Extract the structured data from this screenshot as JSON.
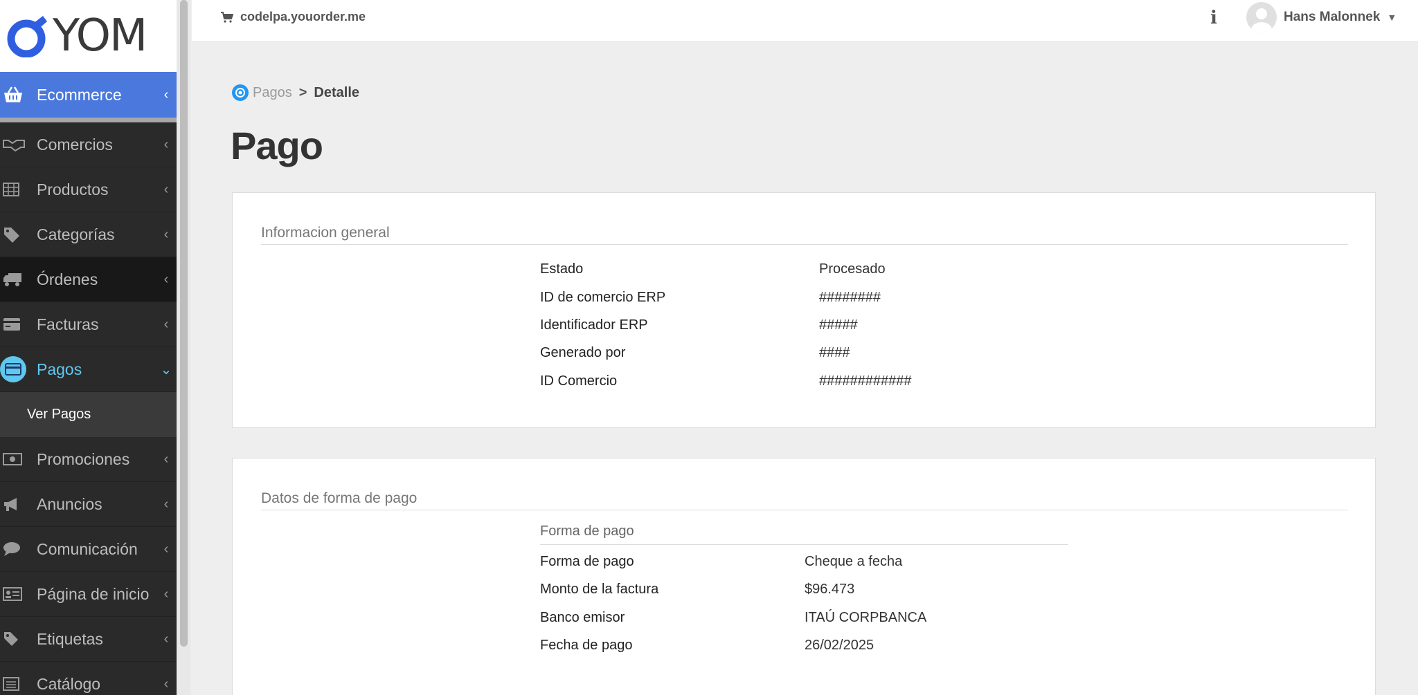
{
  "brand": {
    "name": "YOM"
  },
  "sidebar": {
    "items": [
      {
        "label": "Ecommerce",
        "icon": "basket-icon"
      },
      {
        "label": "Comercios",
        "icon": "handshake-icon"
      },
      {
        "label": "Productos",
        "icon": "table-icon"
      },
      {
        "label": "Categorías",
        "icon": "tags-icon"
      },
      {
        "label": "Órdenes",
        "icon": "truck-icon"
      },
      {
        "label": "Facturas",
        "icon": "credit-card-icon"
      },
      {
        "label": "Pagos",
        "icon": "payment-card-icon"
      },
      {
        "label": "Promociones",
        "icon": "money-icon"
      },
      {
        "label": "Anuncios",
        "icon": "megaphone-icon"
      },
      {
        "label": "Comunicación",
        "icon": "chat-icon"
      },
      {
        "label": "Página de inicio",
        "icon": "id-card-icon"
      },
      {
        "label": "Etiquetas",
        "icon": "tag-icon"
      },
      {
        "label": "Catálogo",
        "icon": "list-icon"
      }
    ],
    "pagos_sub": {
      "label": "Ver Pagos"
    }
  },
  "topbar": {
    "store": "codelpa.youorder.me",
    "user_name": "Hans Malonnek"
  },
  "breadcrumb": {
    "parent": "Pagos",
    "separator": ">",
    "current": "Detalle"
  },
  "page": {
    "title": "Pago"
  },
  "general": {
    "title": "Informacion general",
    "rows": [
      {
        "k": "Estado",
        "v": "Procesado"
      },
      {
        "k": "ID de comercio ERP",
        "v": "########"
      },
      {
        "k": "Identificador ERP",
        "v": "#####"
      },
      {
        "k": "Generado por",
        "v": "####"
      },
      {
        "k": "ID Comercio",
        "v": "############"
      }
    ]
  },
  "payment": {
    "title": "Datos de forma de pago",
    "subtitle": "Forma de pago",
    "rows": [
      {
        "k": "Forma de pago",
        "v": "Cheque a fecha"
      },
      {
        "k": "Monto de la factura",
        "v": "$96.473"
      },
      {
        "k": "Banco emisor",
        "v": "ITAÚ CORPBANCA"
      },
      {
        "k": "Fecha de pago",
        "v": "26/02/2025"
      }
    ]
  },
  "colors": {
    "accent": "#4a78dc",
    "active": "#5fc8ee",
    "sidebar_bg": "#2a2a2a"
  }
}
